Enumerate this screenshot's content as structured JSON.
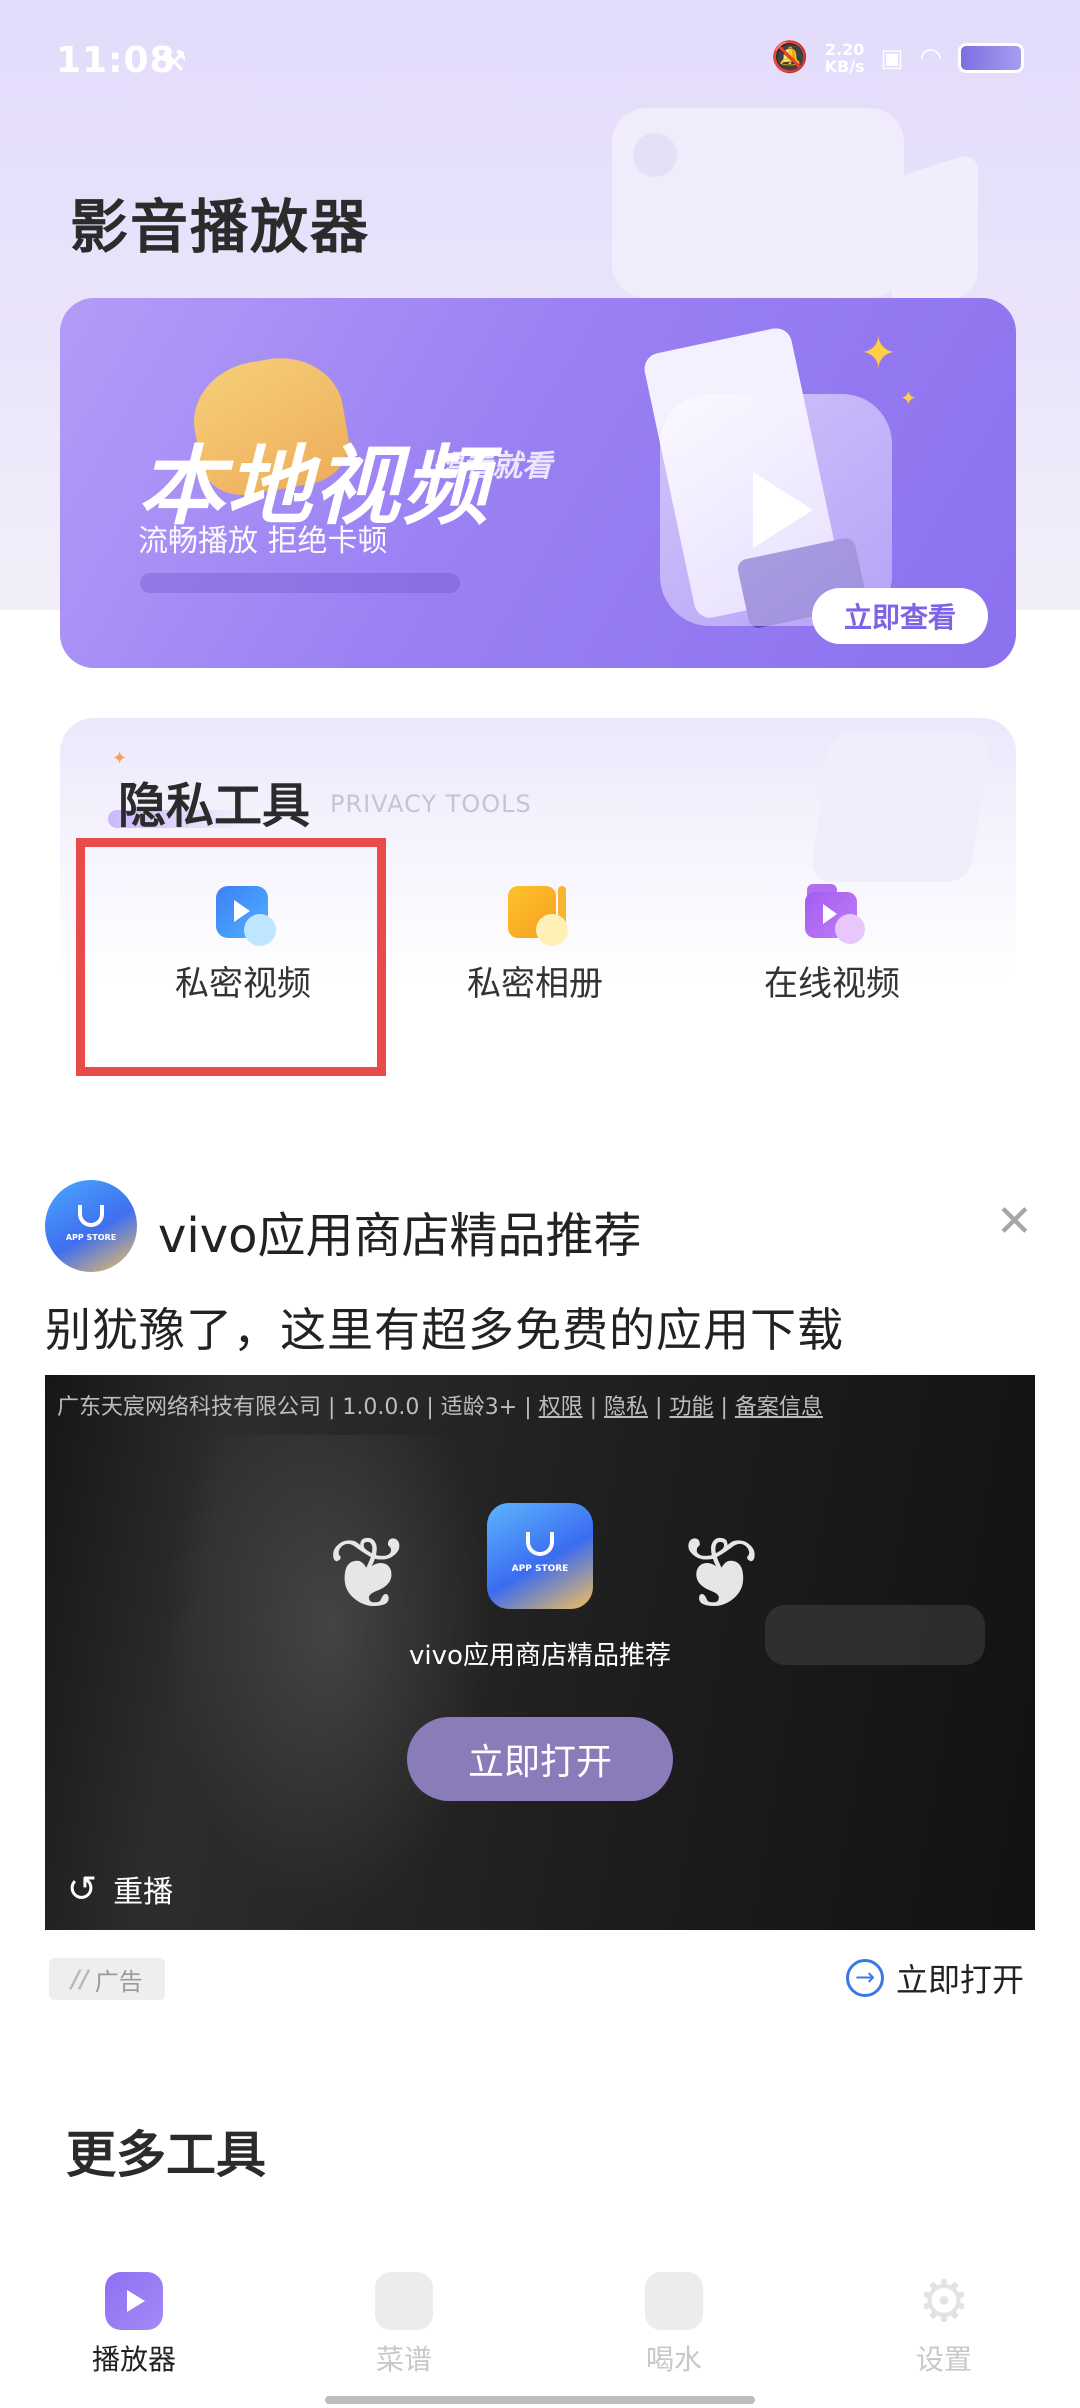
{
  "status_bar": {
    "time": "11:08",
    "net_speed_value": "2.20",
    "net_speed_unit": "KB/s"
  },
  "header": {
    "title": "影音播放器"
  },
  "banner": {
    "title": "本地视频",
    "tagline": "想看就看",
    "subtitle": "流畅播放 拒绝卡顿",
    "button_label": "立即查看"
  },
  "privacy": {
    "title": "隐私工具",
    "subtitle": "PRIVACY TOOLS",
    "tools": [
      {
        "label": "私密视频",
        "icon": "private-video-icon"
      },
      {
        "label": "私密相册",
        "icon": "private-album-icon"
      },
      {
        "label": "在线视频",
        "icon": "online-video-icon"
      }
    ]
  },
  "ad": {
    "title": "vivo应用商店精品推荐",
    "subtitle": "别犹豫了，这里有超多免费的应用下载",
    "meta_prefix": "广东天宸网络科技有限公司 | 1.0.0.0 | 适龄3+ | ",
    "meta_links": [
      "权限",
      "隐私",
      "功能",
      "备案信息"
    ],
    "app_store_label": "APP STORE",
    "center_label": "vivo应用商店精品推荐",
    "open_button": "立即打开",
    "replay_label": "重播",
    "ad_badge": "广告",
    "open_link": "立即打开"
  },
  "more_tools": {
    "title": "更多工具"
  },
  "bottom_nav": {
    "items": [
      {
        "label": "播放器",
        "active": true
      },
      {
        "label": "菜谱",
        "active": false
      },
      {
        "label": "喝水",
        "active": false
      },
      {
        "label": "设置",
        "active": false
      }
    ]
  },
  "colors": {
    "accent": "#8e6ff2",
    "highlight": "#e94b4b",
    "link_blue": "#3a78e8"
  }
}
